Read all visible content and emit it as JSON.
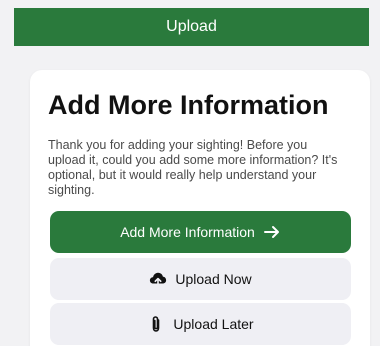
{
  "header": {
    "upload_label": "Upload"
  },
  "card": {
    "title": "Add More Information",
    "body": "Thank you for adding your sighting! Before you upload it, could you add some more information? It's optional, but it would really help understand your sighting."
  },
  "actions": {
    "add_info_label": "Add More Information",
    "upload_now_label": "Upload Now",
    "upload_later_label": "Upload Later"
  },
  "icons": {
    "add_info": "arrow-right-icon",
    "upload_now": "cloud-upload-icon",
    "upload_later": "paperclip-icon"
  },
  "colors": {
    "accent": "#2a7a3c",
    "secondary_button": "#efeff4",
    "background": "#f2f2f4"
  }
}
